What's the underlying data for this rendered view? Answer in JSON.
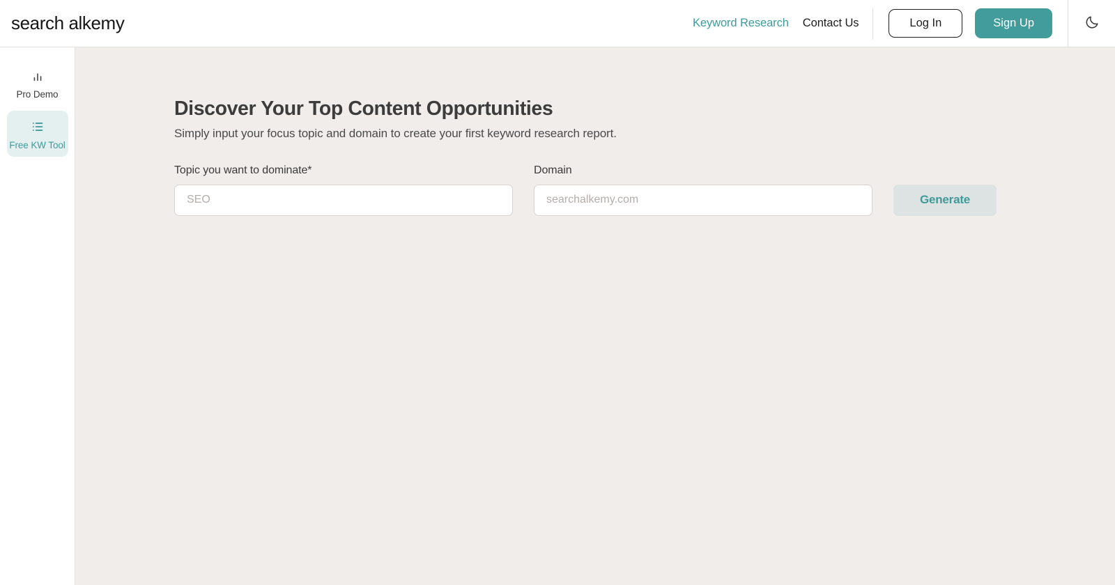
{
  "header": {
    "logo": "search alkemy",
    "nav": [
      {
        "label": "Keyword Research",
        "accent": true
      },
      {
        "label": "Contact Us",
        "accent": false
      }
    ],
    "login_label": "Log In",
    "signup_label": "Sign Up",
    "theme_icon": "moon-icon"
  },
  "sidebar": {
    "items": [
      {
        "label": "Pro Demo",
        "icon": "bar-chart-icon",
        "active": false
      },
      {
        "label": "Free KW Tool",
        "icon": "list-icon",
        "active": true
      }
    ]
  },
  "main": {
    "title": "Discover Your Top Content Opportunities",
    "subtitle": "Simply input your focus topic and domain to create your first keyword research report.",
    "topic_field": {
      "label": "Topic you want to dominate*",
      "placeholder": "SEO",
      "value": ""
    },
    "domain_field": {
      "label": "Domain",
      "placeholder": "searchalkemy.com",
      "value": ""
    },
    "generate_label": "Generate"
  },
  "colors": {
    "accent_teal": "#429c9c",
    "accent_teal_soft": "#e4efef",
    "page_background": "#f0edea",
    "panel_background": "#ffffff",
    "disabled_button_bg": "#dde3e2",
    "text_dark": "#3a3a3a"
  }
}
